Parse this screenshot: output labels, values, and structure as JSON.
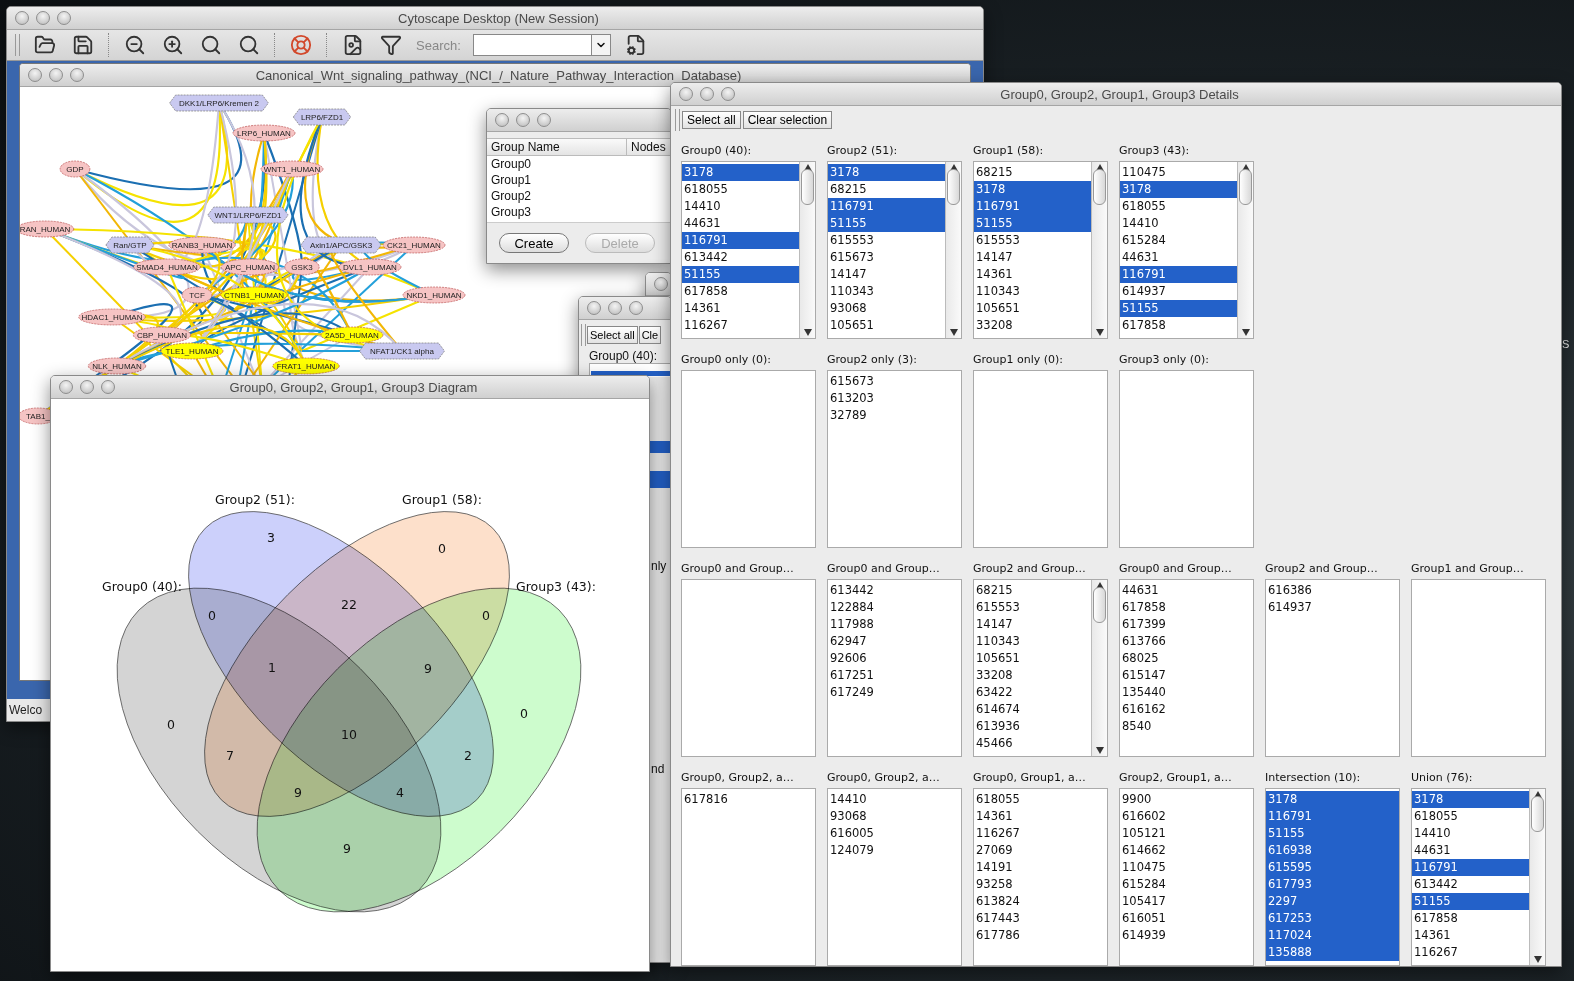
{
  "desktop": {
    "edge_text": "S"
  },
  "main_window": {
    "title": "Cytoscape Desktop (New Session)",
    "search_label": "Search:",
    "status_text": "Welco",
    "network_window": {
      "title": "Canonical_Wnt_signaling_pathway_(NCI_/_Nature_Pathway_Interaction_Database)",
      "nodes": [
        {
          "label": "DKK1/LRP6/Kremen 2",
          "kind": "complex",
          "selected": false
        },
        {
          "label": "LRP6/FZD1",
          "kind": "complex",
          "selected": false
        },
        {
          "label": "LRP6_HUMAN",
          "kind": "protein",
          "selected": false
        },
        {
          "label": "GDP",
          "kind": "protein",
          "selected": false
        },
        {
          "label": "WNT1_HUMAN",
          "kind": "protein",
          "selected": false
        },
        {
          "label": "WNT1/LRP6/FZD1",
          "kind": "complex",
          "selected": false
        },
        {
          "label": "RAN_HUMAN",
          "kind": "protein",
          "selected": false
        },
        {
          "label": "Ran/GTP",
          "kind": "complex",
          "selected": false
        },
        {
          "label": "RANB3_HUMAN",
          "kind": "protein",
          "selected": false
        },
        {
          "label": "Axin1/APC/GSK3",
          "kind": "complex",
          "selected": false
        },
        {
          "label": "CK21_HUMAN",
          "kind": "protein",
          "selected": false
        },
        {
          "label": "SMAD4_HUMAN",
          "kind": "protein",
          "selected": false
        },
        {
          "label": "APC_HUMAN",
          "kind": "protein",
          "selected": false
        },
        {
          "label": "GSK3",
          "kind": "protein",
          "selected": false
        },
        {
          "label": "DVL1_HUMAN",
          "kind": "protein",
          "selected": false
        },
        {
          "label": "TCF",
          "kind": "protein",
          "selected": false
        },
        {
          "label": "CTNB1_HUMAN",
          "kind": "protein",
          "selected": true
        },
        {
          "label": "NKD1_HUMAN",
          "kind": "protein",
          "selected": false
        },
        {
          "label": "HDAC1_HUMAN",
          "kind": "protein",
          "selected": false
        },
        {
          "label": "CBP_HUMAN",
          "kind": "protein",
          "selected": false
        },
        {
          "label": "2A5D_HUMAN",
          "kind": "protein",
          "selected": true
        },
        {
          "label": "TLE1_HUMAN",
          "kind": "protein",
          "selected": true
        },
        {
          "label": "NFAT1/CK1 alpha",
          "kind": "complex",
          "selected": false
        },
        {
          "label": "NLK_HUMAN",
          "kind": "protein",
          "selected": false
        },
        {
          "label": "FRAT1_HUMAN",
          "kind": "protein",
          "selected": true
        },
        {
          "label": "TAB1_",
          "kind": "protein",
          "selected": false
        }
      ]
    }
  },
  "groups_window": {
    "columns": [
      "Group Name",
      "Nodes"
    ],
    "rows": [
      "Group0",
      "Group1",
      "Group2",
      "Group3"
    ],
    "buttons": [
      {
        "label": "Create",
        "disabled": false
      },
      {
        "label": "Delete",
        "disabled": true
      }
    ]
  },
  "hidden_details_window": {
    "buttons": [
      "Select all",
      "Cle"
    ],
    "list_label": "Group0 (40):",
    "fragments": [
      "nly",
      "nd"
    ]
  },
  "diagram_window": {
    "title": "Group0, Group2, Group1, Group3 Diagram",
    "sets": [
      {
        "label": "Group2 (51):",
        "color": "#ccd0fb"
      },
      {
        "label": "Group1 (58):",
        "color": "#fde0cb"
      },
      {
        "label": "Group0 (40):",
        "color": "#d4d4d4"
      },
      {
        "label": "Group3 (43):",
        "color": "#cdfccd"
      }
    ],
    "regions": [
      "3",
      "0",
      "22",
      "0",
      "0",
      "1",
      "9",
      "0",
      "0",
      "10",
      "7",
      "2",
      "9",
      "4",
      "9"
    ]
  },
  "details_window": {
    "title": "Group0, Group2, Group1, Group3 Details",
    "buttons": [
      "Select all",
      "Clear selection"
    ],
    "rows": [
      [
        {
          "label": "Group0 (40):",
          "scrolls": true,
          "items": [
            {
              "text": "3178",
              "selected": true
            },
            {
              "text": "618055",
              "selected": false
            },
            {
              "text": "14410",
              "selected": false
            },
            {
              "text": "44631",
              "selected": false
            },
            {
              "text": "116791",
              "selected": true
            },
            {
              "text": "613442",
              "selected": false
            },
            {
              "text": "51155",
              "selected": true
            },
            {
              "text": "617858",
              "selected": false
            },
            {
              "text": "14361",
              "selected": false
            },
            {
              "text": "116267",
              "selected": false
            }
          ]
        },
        {
          "label": "Group2 (51):",
          "scrolls": true,
          "items": [
            {
              "text": "3178",
              "selected": true
            },
            {
              "text": "68215",
              "selected": false
            },
            {
              "text": "116791",
              "selected": true
            },
            {
              "text": "51155",
              "selected": true
            },
            {
              "text": "615553",
              "selected": false
            },
            {
              "text": "615673",
              "selected": false
            },
            {
              "text": "14147",
              "selected": false
            },
            {
              "text": "110343",
              "selected": false
            },
            {
              "text": "93068",
              "selected": false
            },
            {
              "text": "105651",
              "selected": false
            }
          ]
        },
        {
          "label": "Group1 (58):",
          "scrolls": true,
          "items": [
            {
              "text": "68215",
              "selected": false
            },
            {
              "text": "3178",
              "selected": true
            },
            {
              "text": "116791",
              "selected": true
            },
            {
              "text": "51155",
              "selected": true
            },
            {
              "text": "615553",
              "selected": false
            },
            {
              "text": "14147",
              "selected": false
            },
            {
              "text": "14361",
              "selected": false
            },
            {
              "text": "110343",
              "selected": false
            },
            {
              "text": "105651",
              "selected": false
            },
            {
              "text": "33208",
              "selected": false
            }
          ]
        },
        {
          "label": "Group3 (43):",
          "scrolls": true,
          "items": [
            {
              "text": "110475",
              "selected": false
            },
            {
              "text": "3178",
              "selected": true
            },
            {
              "text": "618055",
              "selected": false
            },
            {
              "text": "14410",
              "selected": false
            },
            {
              "text": "615284",
              "selected": false
            },
            {
              "text": "44631",
              "selected": false
            },
            {
              "text": "116791",
              "selected": true
            },
            {
              "text": "614937",
              "selected": false
            },
            {
              "text": "51155",
              "selected": true
            },
            {
              "text": "617858",
              "selected": false
            }
          ]
        }
      ],
      [
        {
          "label": "Group0 only (0):",
          "scrolls": false
        },
        {
          "label": "Group2 only (3):",
          "scrolls": false,
          "items": [
            {
              "text": "615673",
              "selected": false
            },
            {
              "text": "613203",
              "selected": false
            },
            {
              "text": "32789",
              "selected": false
            }
          ]
        },
        {
          "label": "Group1 only (0):",
          "scrolls": false
        },
        {
          "label": "Group3 only (0):",
          "scrolls": false
        }
      ],
      [
        {
          "label": "Group0 and Group…",
          "scrolls": false
        },
        {
          "label": "Group0 and Group…",
          "scrolls": false,
          "items": [
            {
              "text": "613442",
              "selected": false
            },
            {
              "text": "122884",
              "selected": false
            },
            {
              "text": "117988",
              "selected": false
            },
            {
              "text": "62947",
              "selected": false
            },
            {
              "text": "92606",
              "selected": false
            },
            {
              "text": "617251",
              "selected": false
            },
            {
              "text": "617249",
              "selected": false
            }
          ]
        },
        {
          "label": "Group2 and Group…",
          "scrolls": true,
          "items": [
            {
              "text": "68215",
              "selected": false
            },
            {
              "text": "615553",
              "selected": false
            },
            {
              "text": "14147",
              "selected": false
            },
            {
              "text": "110343",
              "selected": false
            },
            {
              "text": "105651",
              "selected": false
            },
            {
              "text": "33208",
              "selected": false
            },
            {
              "text": "63422",
              "selected": false
            },
            {
              "text": "614674",
              "selected": false
            },
            {
              "text": "613936",
              "selected": false
            },
            {
              "text": "45466",
              "selected": false
            }
          ]
        },
        {
          "label": "Group0 and Group…",
          "scrolls": false,
          "items": [
            {
              "text": "44631",
              "selected": false
            },
            {
              "text": "617858",
              "selected": false
            },
            {
              "text": "617399",
              "selected": false
            },
            {
              "text": "613766",
              "selected": false
            },
            {
              "text": "68025",
              "selected": false
            },
            {
              "text": "615147",
              "selected": false
            },
            {
              "text": "135440",
              "selected": false
            },
            {
              "text": "616162",
              "selected": false
            },
            {
              "text": "8540",
              "selected": false
            }
          ]
        },
        {
          "label": "Group2 and Group…",
          "scrolls": false,
          "items": [
            {
              "text": "616386",
              "selected": false
            },
            {
              "text": "614937",
              "selected": false
            }
          ]
        },
        {
          "label": "Group1 and Group…",
          "scrolls": false
        }
      ],
      [
        {
          "label": "Group0, Group2, a…",
          "scrolls": false,
          "items": [
            {
              "text": "617816",
              "selected": false
            }
          ]
        },
        {
          "label": "Group0, Group2, a…",
          "scrolls": false,
          "items": [
            {
              "text": "14410",
              "selected": false
            },
            {
              "text": "93068",
              "selected": false
            },
            {
              "text": "616005",
              "selected": false
            },
            {
              "text": "124079",
              "selected": false
            }
          ]
        },
        {
          "label": "Group0, Group1, a…",
          "scrolls": false,
          "items": [
            {
              "text": "618055",
              "selected": false
            },
            {
              "text": "14361",
              "selected": false
            },
            {
              "text": "116267",
              "selected": false
            },
            {
              "text": "27069",
              "selected": false
            },
            {
              "text": "14191",
              "selected": false
            },
            {
              "text": "93258",
              "selected": false
            },
            {
              "text": "613824",
              "selected": false
            },
            {
              "text": "617443",
              "selected": false
            },
            {
              "text": "617786",
              "selected": false
            }
          ]
        },
        {
          "label": "Group2, Group1, a…",
          "scrolls": false,
          "items": [
            {
              "text": "9900",
              "selected": false
            },
            {
              "text": "616602",
              "selected": false
            },
            {
              "text": "105121",
              "selected": false
            },
            {
              "text": "614662",
              "selected": false
            },
            {
              "text": "110475",
              "selected": false
            },
            {
              "text": "615284",
              "selected": false
            },
            {
              "text": "105417",
              "selected": false
            },
            {
              "text": "616051",
              "selected": false
            },
            {
              "text": "614939",
              "selected": false
            }
          ]
        },
        {
          "label": "Intersection (10):",
          "scrolls": false,
          "items": [
            {
              "text": "3178",
              "selected": true
            },
            {
              "text": "116791",
              "selected": true
            },
            {
              "text": "51155",
              "selected": true
            },
            {
              "text": "616938",
              "selected": true
            },
            {
              "text": "615595",
              "selected": true
            },
            {
              "text": "617793",
              "selected": true
            },
            {
              "text": "2297",
              "selected": true
            },
            {
              "text": "617253",
              "selected": true
            },
            {
              "text": "117024",
              "selected": true
            },
            {
              "text": "135888",
              "selected": true
            }
          ]
        },
        {
          "label": "Union (76):",
          "scrolls": true,
          "items": [
            {
              "text": "3178",
              "selected": true
            },
            {
              "text": "618055",
              "selected": false
            },
            {
              "text": "14410",
              "selected": false
            },
            {
              "text": "44631",
              "selected": false
            },
            {
              "text": "116791",
              "selected": true
            },
            {
              "text": "613442",
              "selected": false
            },
            {
              "text": "51155",
              "selected": true
            },
            {
              "text": "617858",
              "selected": false
            },
            {
              "text": "14361",
              "selected": false
            },
            {
              "text": "116267",
              "selected": false
            }
          ]
        }
      ]
    ]
  }
}
